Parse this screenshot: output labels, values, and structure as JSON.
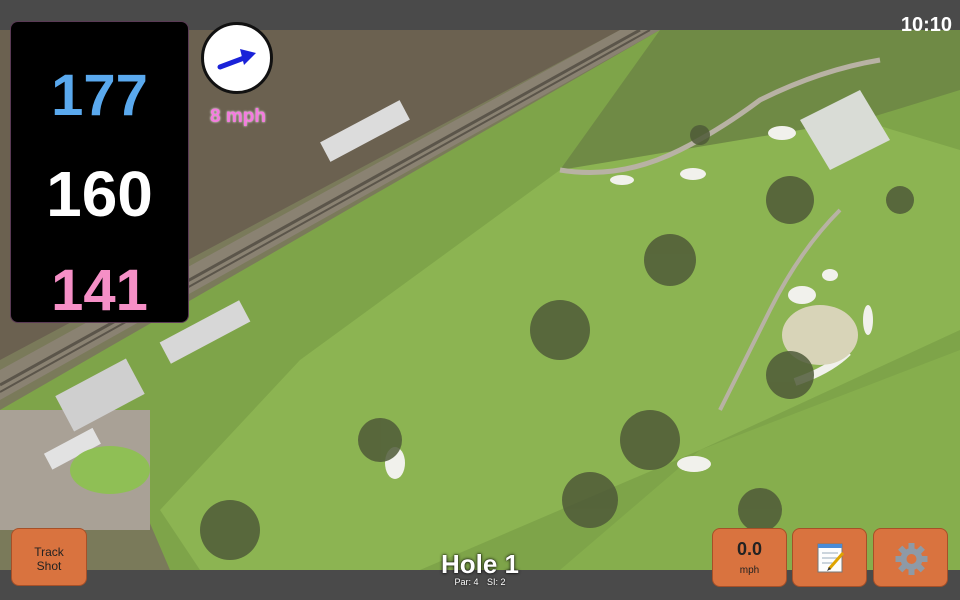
{
  "status": {
    "time": "10:10"
  },
  "yardages": {
    "back": "177",
    "middle": "160",
    "front": "141"
  },
  "wind": {
    "speed_label": "8 mph",
    "direction_icon": "wind-arrow-icon"
  },
  "hole": {
    "title": "Hole 1",
    "par": "Par: 4",
    "si": "SI: 2"
  },
  "buttons": {
    "track_line1": "Track",
    "track_line2": "Shot",
    "wind_value": "0.0",
    "wind_unit": "mph",
    "notes_icon": "notepad-icon",
    "settings_icon": "gear-icon"
  },
  "colors": {
    "back_yardage": "#5aa9ee",
    "middle_yardage": "#ffffff",
    "front_yardage": "#f58fc6",
    "wind_speed": "#f57ae0",
    "button": "#d9733f",
    "arrow": "#1a22d8"
  }
}
